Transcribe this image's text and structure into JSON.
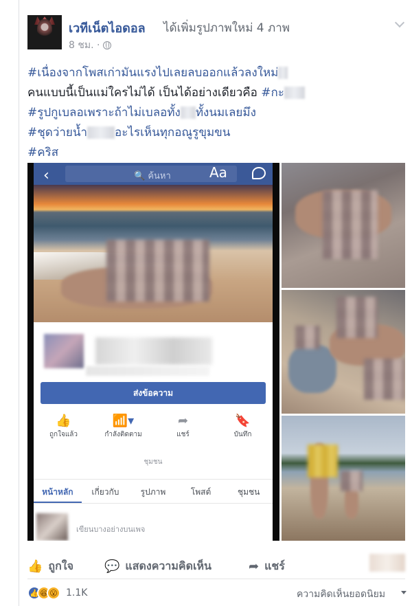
{
  "post": {
    "page_name": "เวทีเน็ตไอดอล",
    "action_text": "ได้เพิ่มรูปภาพใหม่ 4 ภาพ",
    "time": "8 ชม. ·",
    "lines": [
      {
        "a": "#เนื่องจากโพสเก่ามันแรงไปเลยลบออกแล้วลงใหม่",
        "b": ""
      },
      {
        "a": "คนแบบนี้เป็นแม่ใครไม่ได้ เป็นได้อย่างเดียวคือ ",
        "b": "#กะ"
      },
      {
        "a": "#รูปกูเบลอเพราะถ้าไม่เบลอทั้ง",
        "b": "ทั้งนมเลยมึง"
      },
      {
        "a": "#ชุดว่ายน้ำ",
        "b": "อะไรเห็นทุกอณูรูขุมขน"
      },
      {
        "a": "#คริส",
        "b": ""
      }
    ]
  },
  "screenshot": {
    "search_placeholder": "ค้นหา",
    "aa_label": "Aa",
    "send_message": "ส่งข้อความ",
    "actions": [
      {
        "icon": "thumbs-up-icon",
        "glyph": "👍",
        "label": "ถูกใจแล้ว"
      },
      {
        "icon": "rss-icon",
        "glyph": "📶▾",
        "label": "กำลังติดตาม"
      },
      {
        "icon": "share-icon",
        "glyph": "➦",
        "label": "แชร์"
      },
      {
        "icon": "bookmark-icon",
        "glyph": "🔖",
        "label": "บันทึก"
      }
    ],
    "community_label": "ชุมชน",
    "tabs": [
      "หน้าหลัก",
      "เกี่ยวกับ",
      "รูปภาพ",
      "โพสต์",
      "ชุมชน"
    ],
    "compose_placeholder": "เขียนบางอย่างบนเพจ"
  },
  "footer": {
    "like": "ถูกใจ",
    "comment": "แสดงความคิดเห็น",
    "share": "แชร์",
    "reaction_count": "1.1K",
    "sort_label": "ความคิดเห็นยอดนิยม"
  },
  "colors": {
    "link": "#365899",
    "fb_blue": "#4267b2",
    "muted": "#90949c"
  }
}
